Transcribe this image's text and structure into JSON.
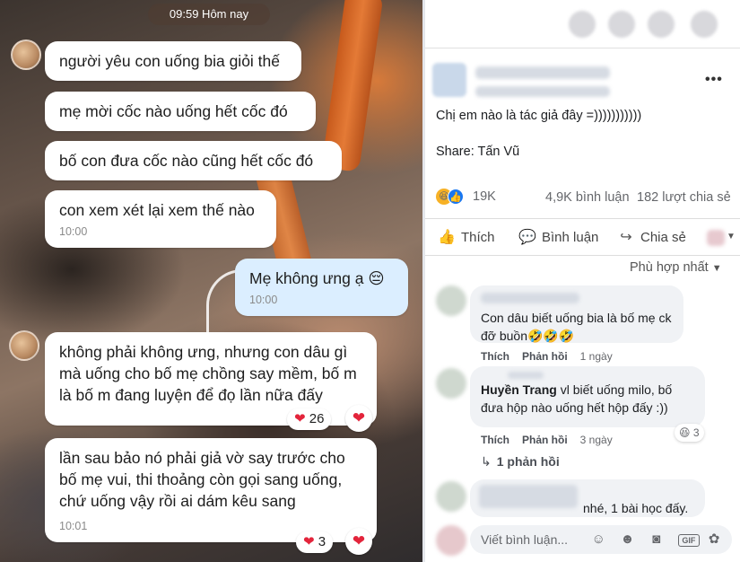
{
  "chat": {
    "time_header": "09:59 Hôm nay",
    "messages": [
      {
        "text": "người yêu con uống bia giỏi thế"
      },
      {
        "text": "mẹ mời cốc nào uống hết cốc đó"
      },
      {
        "text": "bố con đưa cốc nào cũng hết cốc đó"
      },
      {
        "text": "con xem xét lại xem thế nào",
        "time": "10:00"
      },
      {
        "text": "Mẹ không ưng ạ 😔",
        "time": "10:00"
      },
      {
        "text": "không phải không ưng, nhưng con dâu gì mà uống cho bố mẹ chồng say mềm, bố m là bố m đang luyện để đọ lần nữa đấy",
        "react_count": "26"
      },
      {
        "text": "lần sau bảo nó phải giả vờ say trước cho bố mẹ vui, thi thoảng còn gọi sang uống, chứ uống vậy rồi ai dám kêu sang",
        "time": "10:01",
        "react_count": "3"
      }
    ]
  },
  "post": {
    "caption": "Chị em nào là tác giả đây =)))))))))))",
    "share": "Share: Tấn Vũ",
    "reaction_count": "19K",
    "comment_count": "4,9K bình luận",
    "share_count": "182 lượt chia sẻ",
    "actions": {
      "like": "Thích",
      "comment": "Bình luận",
      "share": "Chia sẻ"
    },
    "sort_label": "Phù hợp nhất"
  },
  "comments": [
    {
      "text": "Con dâu biết uống bia là bố mẹ ck đỡ buồn🤣🤣🤣",
      "like": "Thích",
      "reply": "Phản hồi",
      "age": "1 ngày"
    },
    {
      "name": "Huyền Trang",
      "text": "vl biết uống milo, bố đưa hộp nào uống hết hộp đấy :))",
      "like": "Thích",
      "reply": "Phản hồi",
      "age": "3 ngày",
      "react_count": "3",
      "replies": "1 phản hồi"
    },
    {
      "text": "nhé, 1 bài học đấy."
    }
  ],
  "composer": {
    "placeholder": "Viết bình luận..."
  },
  "colors": {
    "fb_blue": "#1877f2",
    "sent_bubble": "#dbeeff",
    "heart": "#e3243b"
  }
}
